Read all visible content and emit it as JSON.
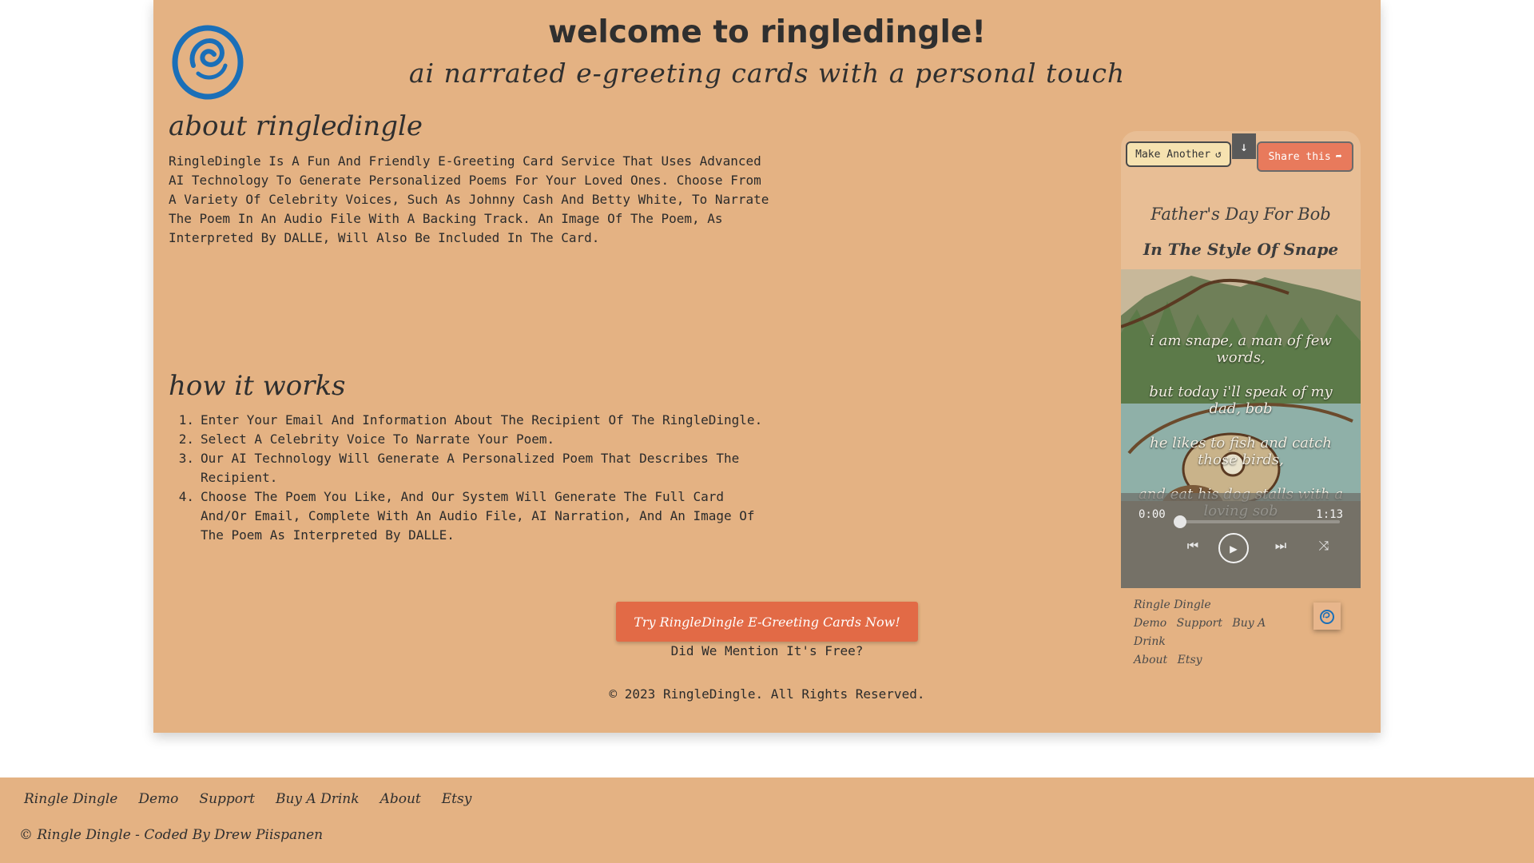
{
  "header": {
    "title": "welcome to ringledingle!",
    "subtitle": "ai narrated e-greeting cards with a personal touch"
  },
  "about": {
    "heading": "about ringledingle",
    "text": "RingleDingle Is A Fun And Friendly E-Greeting Card Service That Uses Advanced AI Technology To Generate Personalized Poems For Your Loved Ones. Choose From A Variety Of Celebrity Voices, Such As Johnny Cash And Betty White, To Narrate The Poem In An Audio File With A Backing Track. An Image Of The Poem, As Interpreted By DALLE, Will Also Be Included In The Card."
  },
  "how": {
    "heading": "how it works",
    "steps": [
      {
        "num": "1.",
        "text": "Enter Your Email And Information About The Recipient Of The RingleDingle."
      },
      {
        "num": "2.",
        "text": "Select A Celebrity Voice To Narrate Your Poem."
      },
      {
        "num": "3.",
        "text": "Our AI Technology Will Generate A Personalized Poem That Describes The Recipient."
      },
      {
        "num": "4.",
        "text": "Choose The Poem You Like, And Our System Will Generate The Full Card And/Or Email, Complete With An Audio File, AI Narration, And An Image Of The Poem As Interpreted By DALLE."
      }
    ]
  },
  "cta": {
    "button": "Try RingleDingle E-Greeting Cards Now!",
    "note": "Did We Mention It's Free?"
  },
  "copyright": "© 2023 RingleDingle. All Rights Reserved.",
  "preview": {
    "make_another": "Make Another",
    "share": "Share this",
    "card_title": "Father's Day For Bob",
    "card_style": "In The Style Of Snape",
    "lyrics": [
      "i am snape, a man of few words,",
      "but today i'll speak of my dad, bob",
      "he likes to fish and catch those birds,",
      "and eat his dog stalls with a loving sob"
    ],
    "player": {
      "current": "0:00",
      "duration": "1:13",
      "progress": 0.0
    },
    "mini_footer": {
      "brand": "Ringle Dingle",
      "links": [
        "Demo",
        "Support",
        "Buy A Drink",
        "About",
        "Etsy"
      ]
    }
  },
  "footer": {
    "links": [
      "Ringle Dingle",
      "Demo",
      "Support",
      "Buy A Drink",
      "About",
      "Etsy"
    ],
    "copy": "© Ringle Dingle - Coded By Drew Piispanen"
  },
  "colors": {
    "background": "#e4b283",
    "accent": "#e26a46",
    "logo_blue": "#1a6fb8"
  }
}
